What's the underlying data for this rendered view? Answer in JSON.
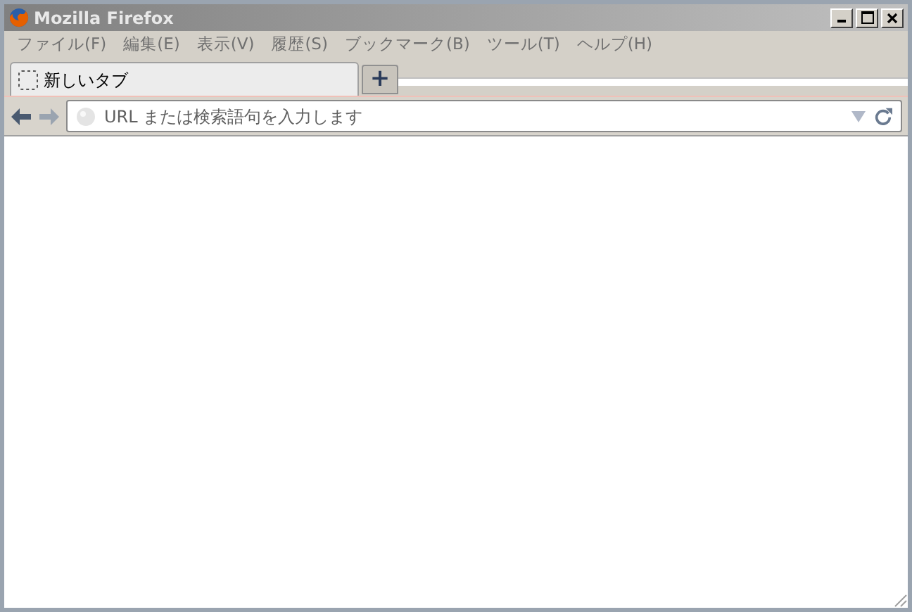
{
  "window": {
    "title": "Mozilla Firefox"
  },
  "menu": [
    "ファイル(F)",
    "編集(E)",
    "表示(V)",
    "履歴(S)",
    "ブックマーク(B)",
    "ツール(T)",
    "ヘルプ(H)"
  ],
  "tabs": [
    {
      "label": "新しいタブ",
      "selected": true
    }
  ],
  "new_tab": "+",
  "url_bar": {
    "placeholder": "URL または検索語句を入力します"
  }
}
